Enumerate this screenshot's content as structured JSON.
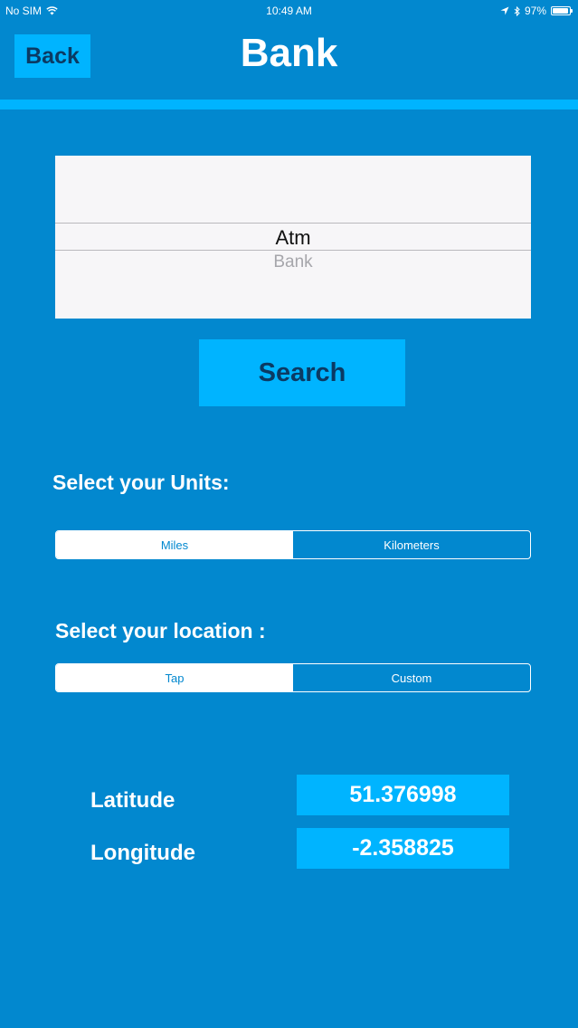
{
  "status_bar": {
    "carrier": "No SIM",
    "time": "10:49 AM",
    "battery": "97%",
    "battery_level": 0.97,
    "icons": [
      "wifi-icon",
      "location-arrow-icon",
      "bluetooth-icon",
      "battery-icon"
    ]
  },
  "nav": {
    "back_label": "Back",
    "title": "Bank"
  },
  "picker": {
    "options": [
      "Atm",
      "Bank"
    ],
    "selected": "Atm",
    "next": "Bank"
  },
  "search": {
    "label": "Search"
  },
  "units": {
    "label": "Select your Units:",
    "options": [
      "Miles",
      "Kilometers"
    ],
    "selected": "Miles"
  },
  "location": {
    "label": "Select your location :",
    "options": [
      "Tap",
      "Custom"
    ],
    "selected": "Tap"
  },
  "coordinates": {
    "latitude_label": "Latitude",
    "latitude_value": "51.376998",
    "longitude_label": "Longitude",
    "longitude_value": "-2.358825"
  },
  "colors": {
    "background": "#0288cf",
    "accent": "#00b4ff",
    "button_text": "#0b3a63",
    "picker_background": "#f7f6f8"
  }
}
